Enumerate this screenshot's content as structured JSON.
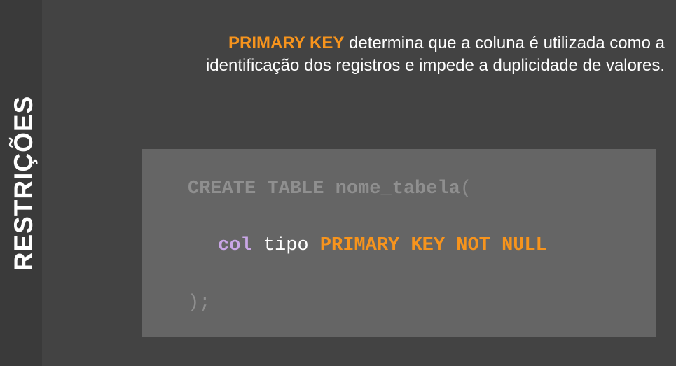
{
  "sidebar": {
    "title": "RESTRIÇÕES"
  },
  "description": {
    "highlight": "PRIMARY KEY",
    "line1_rest": " determina que a coluna é utilizada como a",
    "line2": "identificação dos registros e impede a duplicidade de valores."
  },
  "code": {
    "line1": {
      "keywords": "CREATE TABLE",
      "table_name": "nome_tabela",
      "open_paren": "("
    },
    "line2": {
      "column": "col",
      "type": "tipo",
      "constraint_primary_key": "PRIMARY KEY",
      "constraint_not_null": "NOT NULL"
    },
    "line3": {
      "close": ");"
    }
  },
  "colors": {
    "background": "#434343",
    "side_strip": "#3a3a3a",
    "code_box": "#656565",
    "accent_orange": "#f7941d",
    "column_purple": "#c9a6e6",
    "muted_code": "#8f8f8f",
    "text_white": "#ffffff"
  }
}
